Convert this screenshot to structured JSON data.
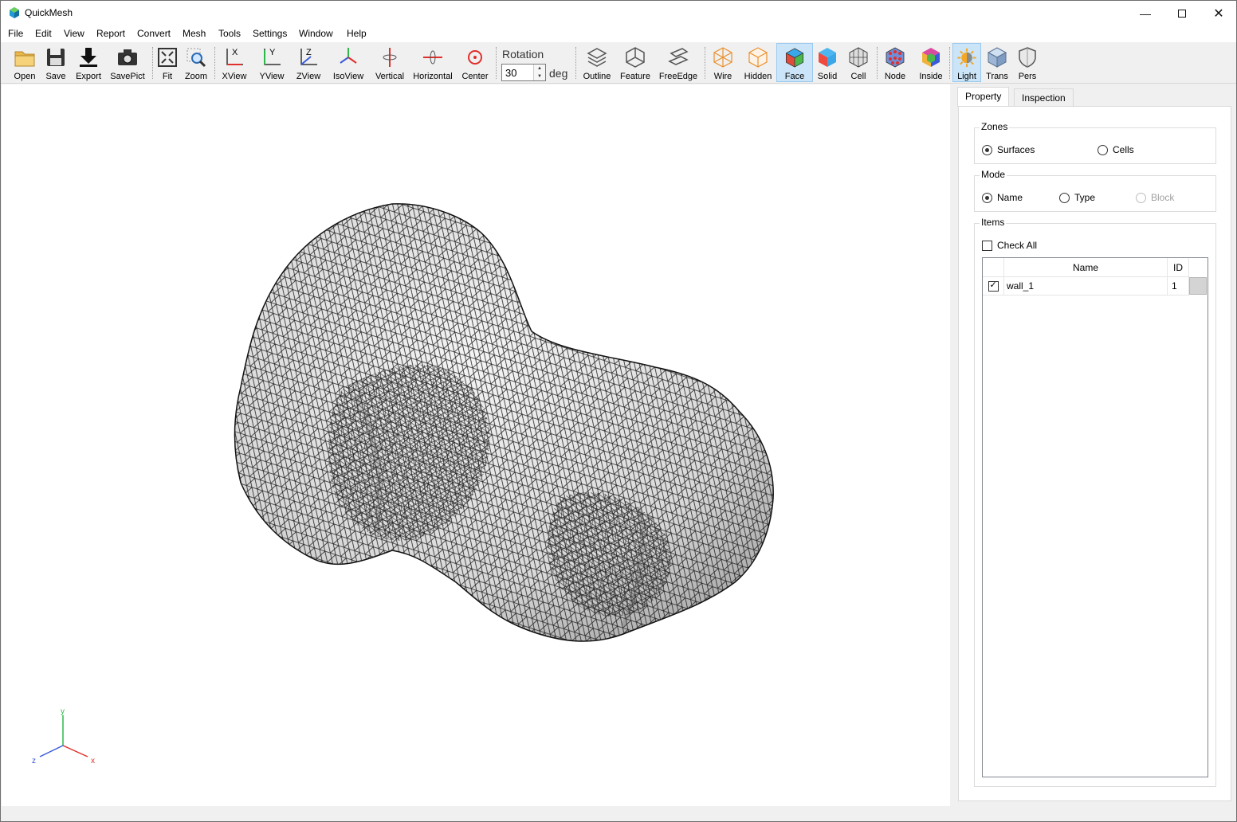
{
  "window": {
    "title": "QuickMesh"
  },
  "menu": [
    "File",
    "Edit",
    "View",
    "Report",
    "Convert",
    "Mesh",
    "Tools",
    "Settings",
    "Window",
    "Help"
  ],
  "toolbar": {
    "open": "Open",
    "save": "Save",
    "export": "Export",
    "savepict": "SavePict",
    "fit": "Fit",
    "zoom": "Zoom",
    "xview": "XView",
    "yview": "YView",
    "zview": "ZView",
    "isoview": "IsoView",
    "vertical": "Vertical",
    "horizontal": "Horizontal",
    "center": "Center",
    "rotation_label": "Rotation",
    "rotation_value": "30",
    "rotation_unit": "deg",
    "outline": "Outline",
    "feature": "Feature",
    "freeedge": "FreeEdge",
    "wire": "Wire",
    "hidden": "Hidden",
    "face": "Face",
    "solid": "Solid",
    "cell": "Cell",
    "node": "Node",
    "inside": "Inside",
    "light": "Light",
    "trans": "Trans",
    "pers": "Pers"
  },
  "toolbar_state": {
    "face_active": true,
    "light_active": true
  },
  "axes": {
    "y": "y",
    "z": "z",
    "x": "x"
  },
  "panel": {
    "tabs": [
      "Property",
      "Inspection"
    ],
    "active_tab": "Property",
    "zones": {
      "title": "Zones",
      "options": [
        {
          "label": "Surfaces",
          "checked": true
        },
        {
          "label": "Cells",
          "checked": false
        }
      ]
    },
    "mode": {
      "title": "Mode",
      "options": [
        {
          "label": "Name",
          "checked": true
        },
        {
          "label": "Type",
          "checked": false
        },
        {
          "label": "Block",
          "checked": false,
          "disabled": true
        }
      ]
    },
    "items": {
      "title": "Items",
      "check_all": "Check All",
      "columns": [
        "Name",
        "ID"
      ],
      "rows": [
        {
          "checked": true,
          "name": "wall_1",
          "id": "1"
        }
      ]
    }
  },
  "colors": {
    "accent": "#cce4f7",
    "axis_x": "#e0302b",
    "axis_y": "#2db84a",
    "axis_z": "#3a5bd9"
  }
}
